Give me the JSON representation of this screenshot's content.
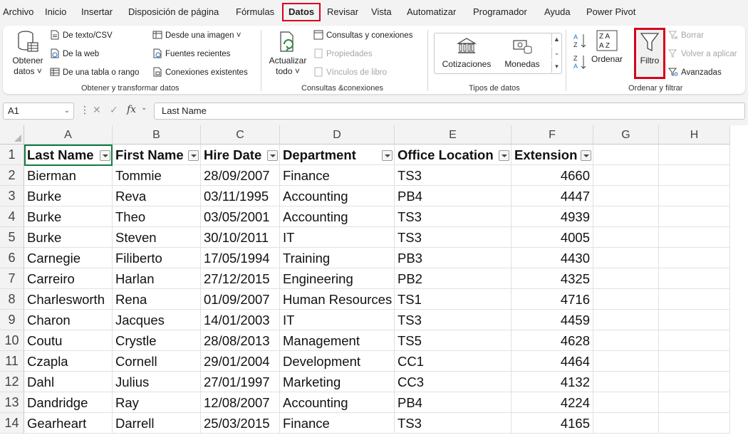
{
  "menu": {
    "tabs": [
      "Archivo",
      "Inicio",
      "Insertar",
      "Disposición de página",
      "Fórmulas",
      "Datos",
      "Revisar",
      "Vista",
      "Automatizar",
      "Programador",
      "Ayuda",
      "Power Pivot"
    ],
    "active_tab": "Datos"
  },
  "ribbon": {
    "obtener": {
      "big_label_1": "Obtener",
      "big_label_2": "datos ˅",
      "from_text": "De texto/CSV",
      "from_web": "De la web",
      "from_table": "De una tabla o rango",
      "from_image": "Desde una imagen ˅",
      "recent": "Fuentes recientes",
      "existing": "Conexiones existentes",
      "group": "Obtener y transformar datos"
    },
    "consultas": {
      "refresh_1": "Actualizar",
      "refresh_2": "todo ˅",
      "queries": "Consultas y conexiones",
      "properties": "Propiedades",
      "links": "Vínculos de libro",
      "group": "Consultas &conexiones"
    },
    "tipos": {
      "stocks": "Cotizaciones",
      "currencies": "Monedas",
      "group": "Tipos de datos"
    },
    "ordenar": {
      "sort": "Ordenar",
      "filter": "Filtro",
      "clear": "Borrar",
      "reapply": "Volver a aplicar",
      "advanced": "Avanzadas",
      "group": "Ordenar y filtrar"
    }
  },
  "formula_bar": {
    "name_box": "A1",
    "fx": "fx",
    "content": "Last Name"
  },
  "columns": [
    "A",
    "B",
    "C",
    "D",
    "E",
    "F",
    "G",
    "H"
  ],
  "headers": [
    "Last Name",
    "First Name",
    "Hire Date",
    "Department",
    "Office Location",
    "Extension"
  ],
  "rows": [
    [
      "Bierman",
      "Tommie",
      "28/09/2007",
      "Finance",
      "TS3",
      "4660"
    ],
    [
      "Burke",
      "Reva",
      "03/11/1995",
      "Accounting",
      "PB4",
      "4447"
    ],
    [
      "Burke",
      "Theo",
      "03/05/2001",
      "Accounting",
      "TS3",
      "4939"
    ],
    [
      "Burke",
      "Steven",
      "30/10/2011",
      "IT",
      "TS3",
      "4005"
    ],
    [
      "Carnegie",
      "Filiberto",
      "17/05/1994",
      "Training",
      "PB3",
      "4430"
    ],
    [
      "Carreiro",
      "Harlan",
      "27/12/2015",
      "Engineering",
      "PB2",
      "4325"
    ],
    [
      "Charlesworth",
      "Rena",
      "01/09/2007",
      "Human Resources",
      "TS1",
      "4716"
    ],
    [
      "Charon",
      "Jacques",
      "14/01/2003",
      "IT",
      "TS3",
      "4459"
    ],
    [
      "Coutu",
      "Crystle",
      "28/08/2013",
      "Management",
      "TS5",
      "4628"
    ],
    [
      "Czapla",
      "Cornell",
      "29/01/2004",
      "Development",
      "CC1",
      "4464"
    ],
    [
      "Dahl",
      "Julius",
      "27/01/1997",
      "Marketing",
      "CC3",
      "4132"
    ],
    [
      "Dandridge",
      "Ray",
      "12/08/2007",
      "Accounting",
      "PB4",
      "4224"
    ],
    [
      "Gearheart",
      "Darrell",
      "25/03/2015",
      "Finance",
      "TS3",
      "4165"
    ]
  ],
  "row_numbers": [
    "1",
    "2",
    "3",
    "4",
    "5",
    "6",
    "7",
    "8",
    "9",
    "10",
    "11",
    "12",
    "13",
    "14"
  ],
  "colors": {
    "accent": "#107c41",
    "highlight": "#d6001c"
  }
}
